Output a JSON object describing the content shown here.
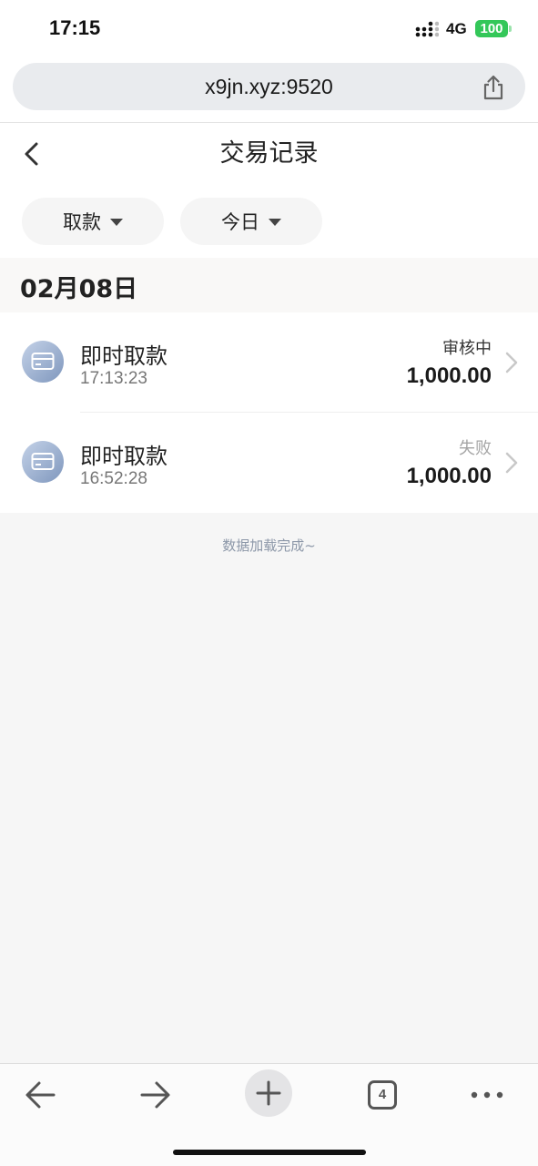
{
  "status_bar": {
    "time": "17:15",
    "network": "4G",
    "battery": "100"
  },
  "browser": {
    "url": "x9jn.xyz:9520",
    "tab_count": "4",
    "icons": [
      "share-icon",
      "back-arrow-icon",
      "forward-arrow-icon",
      "plus-icon",
      "tabs-icon",
      "more-icon"
    ]
  },
  "header": {
    "title": "交易记录",
    "back_icon": "chevron-left-icon"
  },
  "filters": {
    "type": "取款",
    "period": "今日"
  },
  "date_group": "02月08日",
  "records": [
    {
      "title": "即时取款",
      "time": "17:13:23",
      "status": "审核中",
      "amount": "1,000.00"
    },
    {
      "title": "即时取款",
      "time": "16:52:28",
      "status": "失败",
      "amount": "1,000.00"
    }
  ],
  "footer_message": "数据加载完成~",
  "colors": {
    "battery": "#34c759",
    "icon_gradient_start": "#c4d2e8",
    "icon_gradient_end": "#7f97bd",
    "footer_text": "#8c97a8"
  }
}
